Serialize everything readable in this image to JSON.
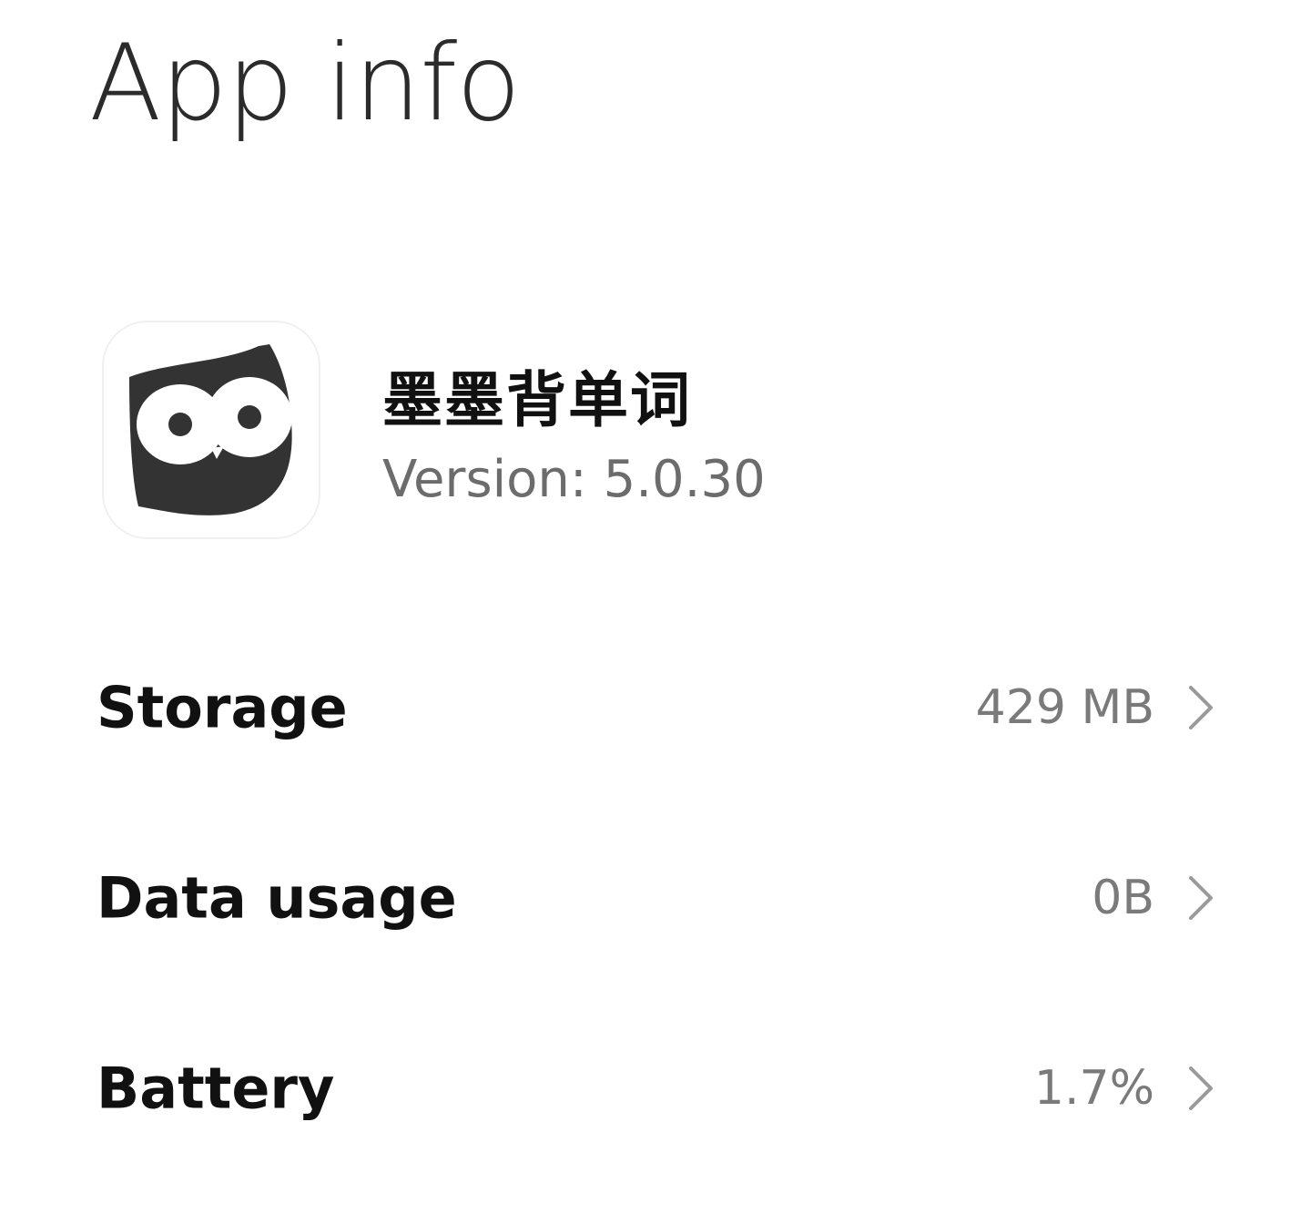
{
  "page": {
    "title": "App info"
  },
  "app": {
    "name": "墨墨背单词",
    "version": "Version: 5.0.30",
    "icon": "owl-logo-icon"
  },
  "settings": {
    "items": [
      {
        "label": "Storage",
        "value": "429 MB",
        "icon": "chevron-right-icon"
      },
      {
        "label": "Data usage",
        "value": "0B",
        "icon": "chevron-right-icon"
      },
      {
        "label": "Battery",
        "value": "1.7%",
        "icon": "chevron-right-icon"
      }
    ]
  },
  "colors": {
    "background": "#ffffff",
    "title": "#2b2b2b",
    "primary_text": "#111111",
    "secondary_text": "#7a7a7a",
    "icon_dark": "#333333",
    "chevron": "#9a9a9a"
  }
}
